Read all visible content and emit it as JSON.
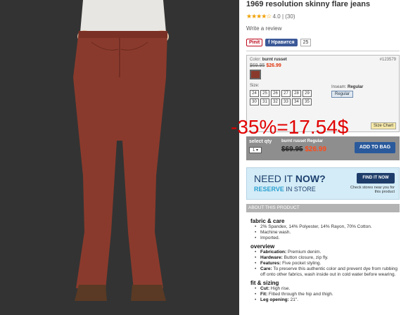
{
  "product": {
    "title": "1969 resolution skinny flare jeans",
    "stars": "★★★★☆",
    "rating": "4.0",
    "review_count": "(30)",
    "write_review": "Write a review"
  },
  "social": {
    "pinit": "Pinit",
    "facebook": "Нравится",
    "facebook_count": "25"
  },
  "options": {
    "color_label": "Color:",
    "color_value": "burnt russet",
    "sku": "#123579",
    "original_price": "$69.95",
    "sale_price": "$26.99",
    "swatch_color": "#8a3a2c",
    "size_label": "Size:",
    "sizes": [
      "24",
      "25",
      "26",
      "27",
      "28",
      "29",
      "30",
      "31",
      "32",
      "33",
      "34",
      "35"
    ],
    "inseam_label": "Inseam:",
    "inseam_value": "Regular",
    "inseam_button": "Regular",
    "size_chart": "Size Chart"
  },
  "buybar": {
    "qty_label": "select qty",
    "qty_value": "1",
    "item_label": "burnt russet Regular",
    "original_price": "$69.95",
    "sale_price": "$26.99",
    "add_to_bag": "ADD TO BAG"
  },
  "overlay": {
    "text": "-35%=17.54$",
    "color": "#e20000"
  },
  "banner": {
    "need_prefix": "NEED IT ",
    "need_bold": "NOW?",
    "reserve_bold": "RESERVE",
    "reserve_rest": " IN STORE",
    "find_button": "FIND IT NOW",
    "find_sub": "Check stores near you for this product"
  },
  "about": {
    "heading": "ABOUT THIS PRODUCT",
    "fabric_title": "fabric & care",
    "fabric_items": [
      "2% Spandex, 14% Polyester, 14% Rayon, 70% Cotton.",
      "Machine wash.",
      "Imported."
    ],
    "overview_title": "overview",
    "overview_items": [
      {
        "label": "Fabrication:",
        "text": " Premium denim."
      },
      {
        "label": "Hardware:",
        "text": " Button closure, zip fly."
      },
      {
        "label": "Features:",
        "text": " Five pocket styling."
      },
      {
        "label": "Care:",
        "text": " To preserve this authentic color and prevent dye from rubbing off onto other fabrics, wash inside out in cold water before wearing."
      }
    ],
    "fit_title": "fit & sizing",
    "fit_items": [
      {
        "label": "Cut:",
        "text": " High rise."
      },
      {
        "label": "Fit:",
        "text": " Fitted through the hip and thigh."
      },
      {
        "label": "Leg opening:",
        "text": " 21\"."
      }
    ]
  },
  "colors": {
    "accent_blue": "#2a5a9c",
    "sale_red": "#e0320b",
    "jeans": "#8a3a2c"
  }
}
